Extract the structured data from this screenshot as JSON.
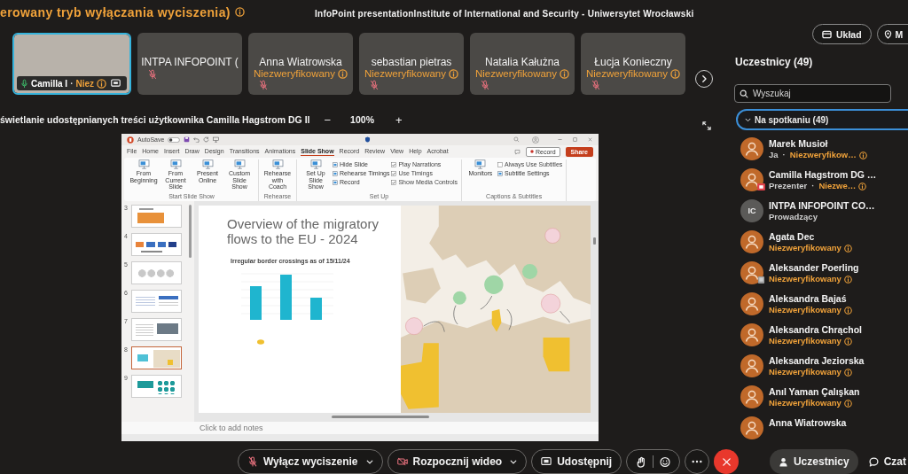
{
  "banner": {
    "text": "erowany tryb wyłączania wyciszenia)"
  },
  "meeting_title": "InfoPoint presentationInstitute of International and Security - Uniwersytet Wrocławski",
  "top_buttons": [
    {
      "kind": "layout",
      "label": "Układ"
    },
    {
      "kind": "pin",
      "label": "M"
    }
  ],
  "tiles": [
    {
      "kind": "video",
      "name": "Camilla I",
      "separator": "·",
      "status": "Niez",
      "muted": false,
      "speaking": true
    },
    {
      "kind": "name",
      "name": "INTPA INFOPOINT (",
      "muted": true,
      "speaking": false
    },
    {
      "kind": "name",
      "name": "Anna Wiatrowska",
      "status": "Niezweryfikowany",
      "muted": true,
      "speaking": false
    },
    {
      "kind": "name",
      "name": "sebastian pietras",
      "status": "Niezweryfikowany",
      "muted": true,
      "speaking": false
    },
    {
      "kind": "name",
      "name": "Natalia Kałużna",
      "status": "Niezweryfikowany",
      "muted": true,
      "speaking": false
    },
    {
      "kind": "name",
      "name": "Łucja Konieczny",
      "status": "Niezweryfikowany",
      "muted": true,
      "speaking": false
    }
  ],
  "share_bar": {
    "title": "świetlanie udostępnianych treści użytkownika Camilla Hagstrom DG II",
    "zoom_out": "−",
    "zoom": "100%",
    "zoom_in": "+"
  },
  "presentation": {
    "autosave": "AutoSave",
    "autosave_on": false,
    "tabs": [
      {
        "label": "File",
        "selected": false
      },
      {
        "label": "Home",
        "selected": false
      },
      {
        "label": "Insert",
        "selected": false
      },
      {
        "label": "Draw",
        "selected": false
      },
      {
        "label": "Design",
        "selected": false
      },
      {
        "label": "Transitions",
        "selected": false
      },
      {
        "label": "Animations",
        "selected": false
      },
      {
        "label": "Slide Show",
        "selected": true
      },
      {
        "label": "Record",
        "selected": false
      },
      {
        "label": "Review",
        "selected": false
      },
      {
        "label": "View",
        "selected": false
      },
      {
        "label": "Help",
        "selected": false
      },
      {
        "label": "Acrobat",
        "selected": false
      }
    ],
    "record_button": "Record",
    "share_button": "Share",
    "ribbon_groups": [
      {
        "label": "Start Slide Show",
        "commands": [
          {
            "kind": "large",
            "label": "From Beginning"
          },
          {
            "kind": "large",
            "label": "From Current Slide"
          },
          {
            "kind": "large",
            "label": "Present Online"
          },
          {
            "kind": "large",
            "label": "Custom Slide Show"
          }
        ]
      },
      {
        "label": "Rehearse",
        "commands": [
          {
            "kind": "large",
            "label": "Rehearse with Coach"
          }
        ]
      },
      {
        "label": "Set Up",
        "commands": [
          {
            "kind": "large",
            "label": "Set Up Slide Show"
          },
          {
            "kind": "small",
            "label": "Hide Slide"
          },
          {
            "kind": "small",
            "label": "Rehearse Timings"
          },
          {
            "kind": "small",
            "label": "Record"
          },
          {
            "kind": "check",
            "label": "Play Narrations",
            "checked": true
          },
          {
            "kind": "check",
            "label": "Use Timings",
            "checked": true
          },
          {
            "kind": "check",
            "label": "Show Media Controls",
            "checked": true
          }
        ]
      },
      {
        "label": "Captions & Subtitles",
        "commands": [
          {
            "kind": "large",
            "label": "Monitors"
          },
          {
            "kind": "check",
            "label": "Always Use Subtitles",
            "checked": false
          },
          {
            "kind": "small",
            "label": "Subtitle Settings"
          }
        ]
      }
    ],
    "slides": [
      {
        "number": "3",
        "kind": "orange",
        "selected": false
      },
      {
        "number": "4",
        "kind": "logos",
        "selected": false
      },
      {
        "number": "5",
        "kind": "circles",
        "selected": false
      },
      {
        "number": "6",
        "kind": "table",
        "selected": false
      },
      {
        "number": "7",
        "kind": "photo",
        "selected": false
      },
      {
        "number": "8",
        "kind": "map",
        "selected": true
      },
      {
        "number": "9",
        "kind": "diagram",
        "selected": false
      }
    ],
    "slide": {
      "title": "Overview of the migratory flows to the EU - 2024",
      "chart_title": "Irregular border crossings as of 15/11/24"
    },
    "notes": {
      "placeholder": "Click to add notes"
    }
  },
  "participants": {
    "title": "Uczestnicy (49)",
    "search": {
      "placeholder": "Wyszukaj"
    },
    "group": {
      "label": "Na spotkaniu (49)",
      "expanded": true
    },
    "people": [
      {
        "kind": "person",
        "name": "Marek Musioł",
        "role": "Ja",
        "separator": "·",
        "status": "Niezweryfikow…",
        "presenting": false,
        "device_badge": false
      },
      {
        "kind": "person",
        "name": "Camilla Hagstrom DG …",
        "role": "Prezenter",
        "separator": "·",
        "status": "Niezwe…",
        "presenting": true,
        "device_badge": false
      },
      {
        "kind": "initials",
        "initials": "IC",
        "name": "INTPA INFOPOINT CO…",
        "role": "Prowadzący",
        "presenting": false,
        "device_badge": false
      },
      {
        "kind": "person",
        "name": "Agata Dec",
        "status": "Niezweryfikowany",
        "presenting": false,
        "device_badge": false
      },
      {
        "kind": "person",
        "name": "Aleksander Poerling",
        "status": "Niezweryfikowany",
        "presenting": false,
        "device_badge": true
      },
      {
        "kind": "person",
        "name": "Aleksandra Bajaś",
        "status": "Niezweryfikowany",
        "presenting": false,
        "device_badge": false
      },
      {
        "kind": "person",
        "name": "Aleksandra Chrąchol",
        "status": "Niezweryfikowany",
        "presenting": false,
        "device_badge": false
      },
      {
        "kind": "person",
        "name": "Aleksandra Jeziorska",
        "status": "Niezweryfikowany",
        "presenting": false,
        "device_badge": false
      },
      {
        "kind": "person",
        "name": "Anıl Yaman Çalışkan",
        "status": "Niezweryfikowany",
        "presenting": false,
        "device_badge": false
      },
      {
        "kind": "person",
        "name": "Anna Wiatrowska",
        "presenting": false,
        "device_badge": false
      }
    ]
  },
  "toolbar": {
    "controls": [
      {
        "kind": "mute",
        "label": "Wyłącz wyciszenie",
        "menu": true
      },
      {
        "kind": "video",
        "label": "Rozpocznij wideo",
        "menu": true
      },
      {
        "kind": "share",
        "label": "Udostępnij",
        "menu": false
      },
      {
        "kind": "reactions"
      },
      {
        "kind": "more"
      },
      {
        "kind": "leave"
      }
    ],
    "panels": [
      {
        "kind": "participants",
        "label": "Uczestnicy",
        "selected": true
      },
      {
        "kind": "chat",
        "label": "Czat",
        "selected": false
      }
    ]
  }
}
